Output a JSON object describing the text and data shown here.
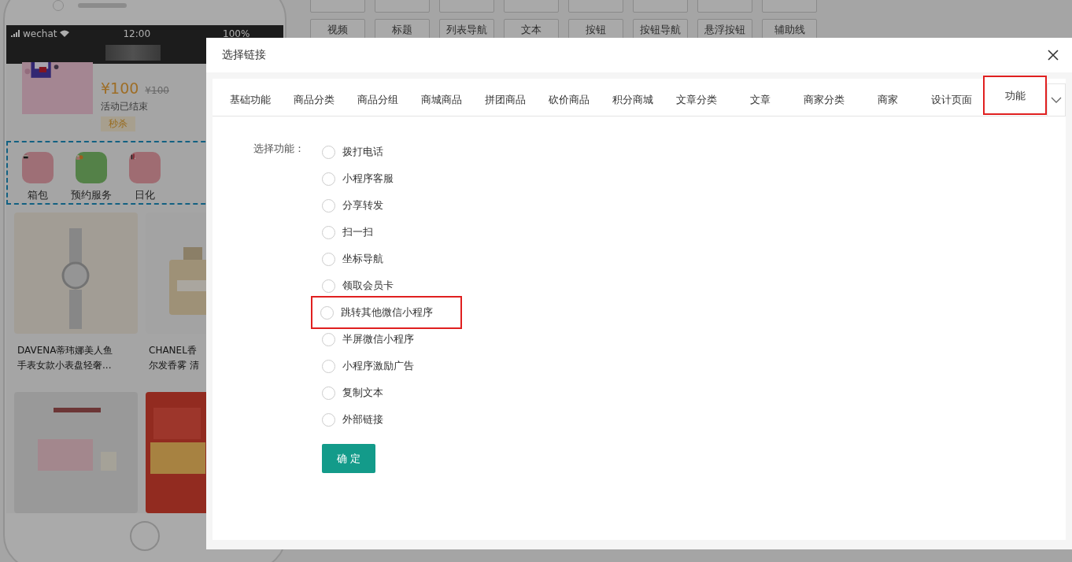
{
  "builder": {
    "component_rows": [
      [
        "视频",
        "标题",
        "列表导航",
        "文本",
        "按钮",
        "按钮导航",
        "悬浮按钮",
        "辅助线"
      ]
    ]
  },
  "phone": {
    "status": {
      "carrier": "wechat",
      "time": "12:00",
      "battery": "100%"
    },
    "promo": {
      "price": "¥100",
      "original_price": "¥100",
      "status": "活动已结束",
      "tag": "秒杀"
    },
    "nav_items": [
      {
        "label": "箱包"
      },
      {
        "label": "预约服务"
      },
      {
        "label": "日化"
      }
    ],
    "products": [
      {
        "lines": [
          "DAVENA蒂玮娜美人鱼",
          "手表女款小表盘轻奢..."
        ]
      },
      {
        "lines": [
          "CHANEL香",
          "尔发香雾 清"
        ]
      }
    ]
  },
  "modal": {
    "title": "选择链接",
    "tabs": [
      {
        "label": "基础功能",
        "selected": false,
        "highlighted": false
      },
      {
        "label": "商品分类",
        "selected": false,
        "highlighted": false
      },
      {
        "label": "商品分组",
        "selected": false,
        "highlighted": false
      },
      {
        "label": "商城商品",
        "selected": false,
        "highlighted": false
      },
      {
        "label": "拼团商品",
        "selected": false,
        "highlighted": false
      },
      {
        "label": "砍价商品",
        "selected": false,
        "highlighted": false
      },
      {
        "label": "积分商城",
        "selected": false,
        "highlighted": false
      },
      {
        "label": "文章分类",
        "selected": false,
        "highlighted": false
      },
      {
        "label": "文章",
        "selected": false,
        "highlighted": false
      },
      {
        "label": "商家分类",
        "selected": false,
        "highlighted": false
      },
      {
        "label": "商家",
        "selected": false,
        "highlighted": false
      },
      {
        "label": "设计页面",
        "selected": false,
        "highlighted": false
      },
      {
        "label": "功能",
        "selected": true,
        "highlighted": true
      }
    ],
    "field_label": "选择功能：",
    "options": [
      {
        "label": "拨打电话",
        "selected": false,
        "highlighted": false
      },
      {
        "label": "小程序客服",
        "selected": false,
        "highlighted": false
      },
      {
        "label": "分享转发",
        "selected": false,
        "highlighted": false
      },
      {
        "label": "扫一扫",
        "selected": false,
        "highlighted": false
      },
      {
        "label": "坐标导航",
        "selected": false,
        "highlighted": false
      },
      {
        "label": "领取会员卡",
        "selected": false,
        "highlighted": false
      },
      {
        "label": "跳转其他微信小程序",
        "selected": false,
        "highlighted": true
      },
      {
        "label": "半屏微信小程序",
        "selected": false,
        "highlighted": false
      },
      {
        "label": "小程序激励广告",
        "selected": false,
        "highlighted": false
      },
      {
        "label": "复制文本",
        "selected": false,
        "highlighted": false
      },
      {
        "label": "外部链接",
        "selected": false,
        "highlighted": false
      }
    ],
    "confirm": "确 定"
  }
}
